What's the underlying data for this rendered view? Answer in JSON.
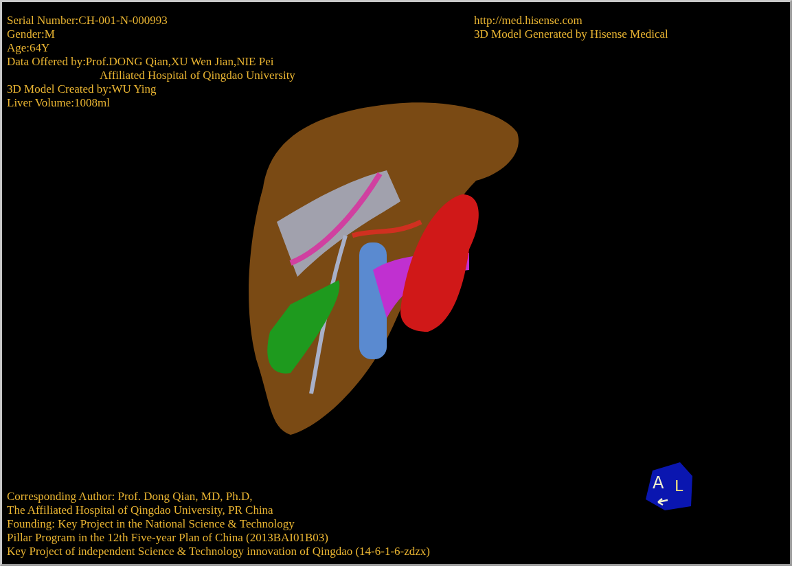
{
  "patient_info": [
    {
      "text": "Serial Number:CH-001-N-000993",
      "indented": false
    },
    {
      "text": "Gender:M",
      "indented": false
    },
    {
      "text": "Age:64Y",
      "indented": false
    },
    {
      "text": "Data Offered by:Prof.DONG Qian,XU Wen Jian,NIE Pei",
      "indented": false
    },
    {
      "text": "Affiliated Hospital of Qingdao University",
      "indented": true
    },
    {
      "text": "3D Model Created by:WU Ying",
      "indented": false
    },
    {
      "text": "Liver Volume:1008ml",
      "indented": false
    }
  ],
  "generator_info": [
    "http://med.hisense.com",
    "3D Model Generated by Hisense Medical"
  ],
  "credits": [
    "Corresponding Author: Prof. Dong Qian, MD, Ph.D,",
    "The Affiliated Hospital of Qingdao University, PR China",
    "Founding: Key Project in the National Science & Technology",
    "Pillar Program in the 12th Five-year Plan of China (2013BAI01B03)",
    "Key Project of independent Science & Technology innovation of Qingdao (14-6-1-6-zdzx)"
  ],
  "orientation_cube": {
    "front_label": "A",
    "side_label": "L"
  }
}
